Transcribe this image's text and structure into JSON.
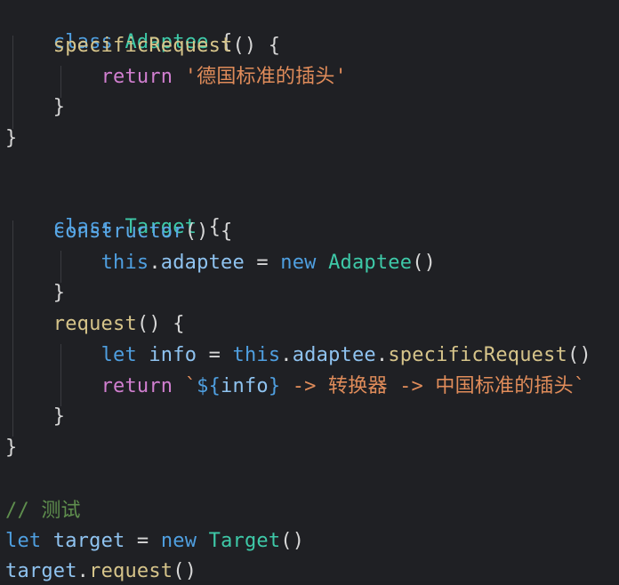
{
  "code": {
    "l1": {
      "kw": "class",
      "name": "Adaptee",
      "brace": "{"
    },
    "l2": {
      "fn": "specificRequest",
      "rest": "() {"
    },
    "l3": {
      "kw": "return",
      "str": "'德国标准的插头'"
    },
    "l4": {
      "txt": "}"
    },
    "l5": {
      "txt": "}"
    },
    "l7": {
      "kw": "class",
      "name": "Target",
      "brace": "{"
    },
    "l8": {
      "fn": "constructor",
      "rest": "() {"
    },
    "l9": {
      "this": "this",
      "prop": "adaptee",
      "eq": "=",
      "kw": "new",
      "cls": "Adaptee",
      "rest": "()"
    },
    "l10": {
      "txt": "}"
    },
    "l11": {
      "fn": "request",
      "rest": "() {"
    },
    "l12": {
      "kw": "let",
      "var": "info",
      "eq": "=",
      "this": "this",
      "prop": "adaptee",
      "fn": "specificRequest",
      "rest": "()"
    },
    "l13": {
      "kw": "return",
      "tick": "`",
      "open": "${",
      "var": "info",
      "close": "}",
      "text": " -> 转换器 -> 中国标准的插头`"
    },
    "l14": {
      "txt": "}"
    },
    "l15": {
      "txt": "}"
    },
    "l17": {
      "comment": "// 测试"
    },
    "l18": {
      "kw": "let",
      "var": "target",
      "eq": "=",
      "kw2": "new",
      "cls": "Target",
      "rest": "()"
    },
    "l19": {
      "var": "target",
      "fn": "request",
      "rest": "()"
    }
  }
}
